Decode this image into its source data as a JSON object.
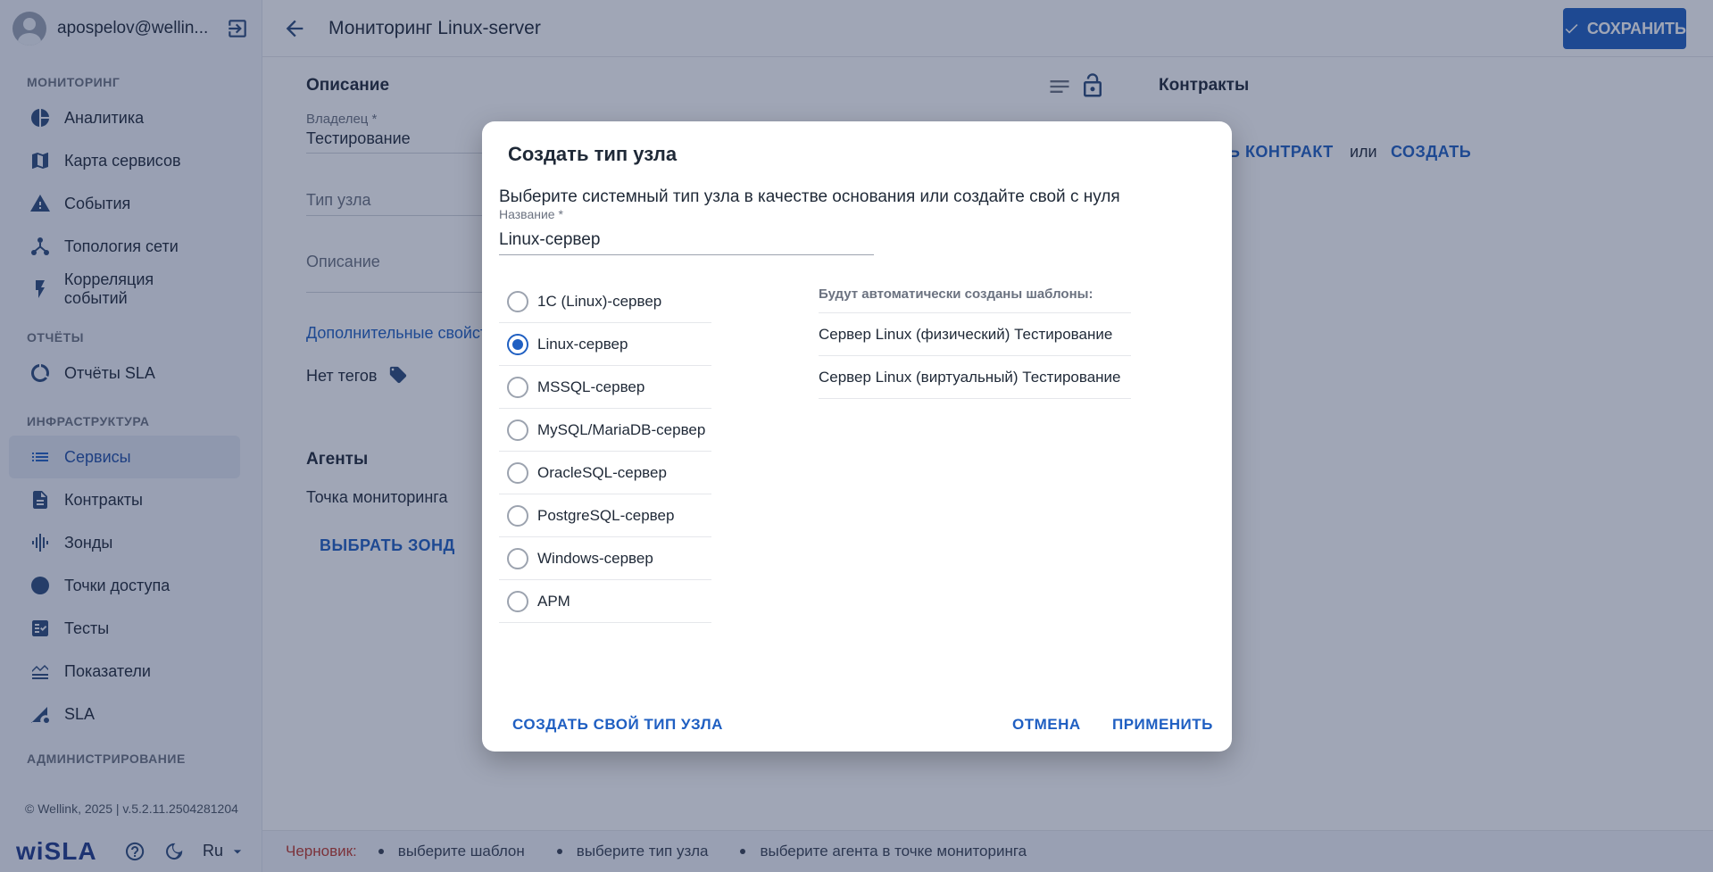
{
  "sidebar": {
    "user_name": "apospelov@wellin...",
    "sections": {
      "monitoring": "МОНИТОРИНГ",
      "reports": "ОТЧЁТЫ",
      "infrastructure": "ИНФРАСТРУКТУРА",
      "administration": "АДМИНИСТРИРОВАНИЕ"
    },
    "items": {
      "analytics": "Аналитика",
      "service_map": "Карта сервисов",
      "events": "События",
      "topology": "Топология сети",
      "correlation": "Корреляция событий",
      "sla_reports": "Отчёты SLA",
      "services": "Сервисы",
      "contracts": "Контракты",
      "probes": "Зонды",
      "access_points": "Точки доступа",
      "tests": "Тесты",
      "indicators": "Показатели",
      "sla": "SLA"
    },
    "copyright": "© Wellink, 2025 | v.5.2.11.2504281204",
    "logo": "wiSLA",
    "lang": "Ru"
  },
  "header": {
    "title": "Мониторинг Linux-server",
    "save_label": "СОХРАНИТЬ"
  },
  "main": {
    "description_title": "Описание",
    "owner_label": "Владелец *",
    "owner_value": "Тестирование",
    "node_type_placeholder": "Тип узла",
    "description_placeholder": "Описание",
    "additional_props": "Дополнительные свойст",
    "no_tags": "Нет тегов",
    "agents_title": "Агенты",
    "monitoring_point": "Точка мониторинга",
    "select_probe": "ВЫБРАТЬ ЗОНД",
    "contracts_title": "Контракты",
    "add_contract": "Ь КОНТРАКТ",
    "or": "или",
    "create": "СОЗДАТЬ"
  },
  "status": {
    "draft_label": "Черновик:",
    "items": [
      "выберите шаблон",
      "выберите тип узла",
      "выберите агента в точке мониторинга"
    ]
  },
  "dialog": {
    "title": "Создать тип узла",
    "subtitle": "Выберите системный тип узла в качестве основания или создайте свой с нуля",
    "name_label": "Название *",
    "name_value": "Linux-сервер",
    "types": [
      {
        "label": "1С (Linux)-сервер",
        "checked": false
      },
      {
        "label": "Linux-сервер",
        "checked": true
      },
      {
        "label": "MSSQL-сервер",
        "checked": false
      },
      {
        "label": "MySQL/MariaDB-сервер",
        "checked": false
      },
      {
        "label": "OracleSQL-сервер",
        "checked": false
      },
      {
        "label": "PostgreSQL-сервер",
        "checked": false
      },
      {
        "label": "Windows-сервер",
        "checked": false
      },
      {
        "label": "APM",
        "checked": false
      }
    ],
    "templates_title": "Будут автоматически созданы шаблоны:",
    "templates": [
      "Сервер Linux (физический) Тестирование",
      "Сервер Linux (виртуальный) Тестирование"
    ],
    "create_own": "СОЗДАТЬ СВОЙ ТИП УЗЛА",
    "cancel": "ОТМЕНА",
    "apply": "ПРИМЕНИТЬ"
  }
}
